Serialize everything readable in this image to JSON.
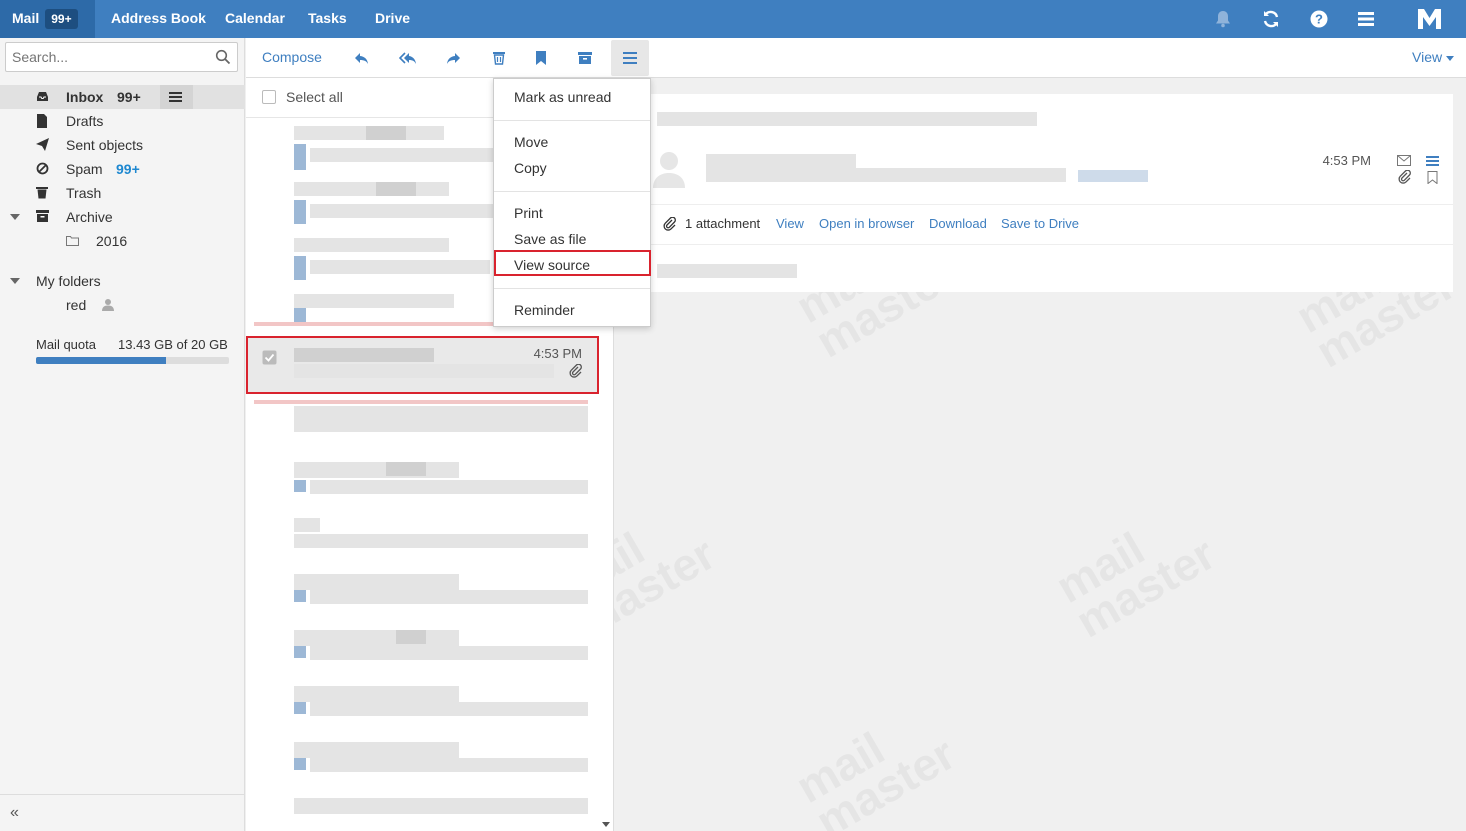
{
  "topbar": {
    "tabs": [
      {
        "label": "Mail",
        "badge": "99+"
      },
      {
        "label": "Address Book"
      },
      {
        "label": "Calendar"
      },
      {
        "label": "Tasks"
      },
      {
        "label": "Drive"
      }
    ],
    "icons": [
      "bell-icon",
      "refresh-icon",
      "help-icon",
      "menu-icon",
      "logo-icon"
    ]
  },
  "search": {
    "placeholder": "Search..."
  },
  "sidebar": {
    "folders": [
      {
        "label": "Inbox",
        "count": "99+",
        "icon": "inbox-icon"
      },
      {
        "label": "Drafts",
        "icon": "draft-icon"
      },
      {
        "label": "Sent objects",
        "icon": "send-icon"
      },
      {
        "label": "Spam",
        "count": "99+",
        "icon": "spam-icon"
      },
      {
        "label": "Trash",
        "icon": "trash-icon"
      },
      {
        "label": "Archive",
        "icon": "archive-icon"
      },
      {
        "label": "2016",
        "icon": "folder-icon"
      }
    ],
    "my_folders": {
      "label": "My folders",
      "items": [
        {
          "label": "red",
          "icon": "user-icon"
        }
      ]
    },
    "quota": {
      "label": "Mail quota",
      "value": "13.43 GB of 20 GB",
      "used_fraction": 0.6715
    },
    "collapse": "«"
  },
  "toolbar": {
    "compose": "Compose",
    "view": "View",
    "icons": [
      "reply-icon",
      "reply-all-icon",
      "forward-icon",
      "delete-icon",
      "flag-icon",
      "archive-icon",
      "more-icon"
    ]
  },
  "list": {
    "select_all": "Select all",
    "selected_time": "4:53 PM"
  },
  "menu": {
    "items": [
      "Mark as unread",
      "Move",
      "Copy",
      "Print",
      "Save as file",
      "View source",
      "Reminder"
    ]
  },
  "reader": {
    "time": "4:53 PM",
    "attachment_count": "1 attachment",
    "actions": [
      "View",
      "Open in browser",
      "Download",
      "Save to Drive"
    ]
  },
  "watermark": {
    "line1": "mail",
    "line2": "master"
  },
  "colors": {
    "brand": "#3f7fc0",
    "highlight": "#d9232e"
  }
}
